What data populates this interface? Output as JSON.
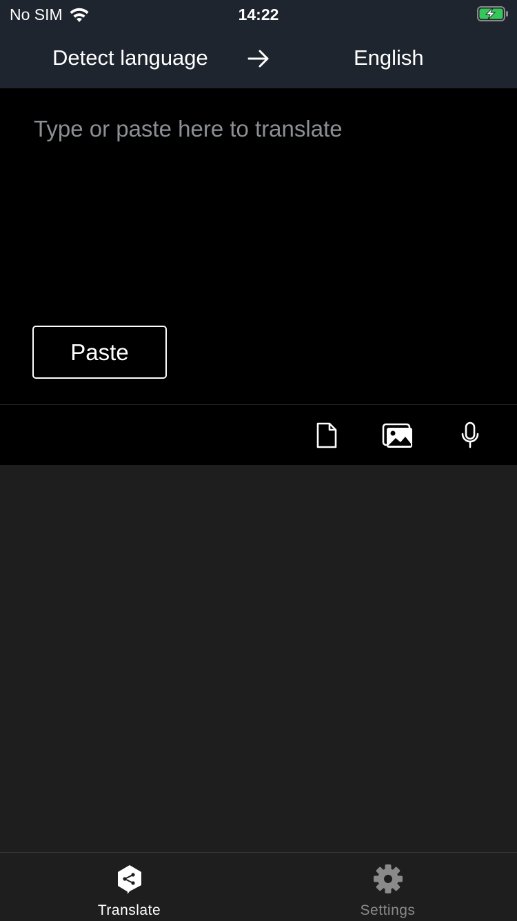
{
  "status_bar": {
    "carrier": "No SIM",
    "time": "14:22",
    "battery_state": "charging",
    "battery_color": "#34c759"
  },
  "language_bar": {
    "source_language": "Detect language",
    "target_language": "English",
    "swap_icon": "arrow-right-icon"
  },
  "input": {
    "placeholder": "Type or paste here to translate",
    "paste_label": "Paste"
  },
  "toolbar": {
    "icons": [
      "document-icon",
      "image-icon",
      "microphone-icon"
    ]
  },
  "tabs": [
    {
      "label": "Translate",
      "icon": "deepl-logo-icon",
      "active": true
    },
    {
      "label": "Settings",
      "icon": "gear-icon",
      "active": false
    }
  ]
}
